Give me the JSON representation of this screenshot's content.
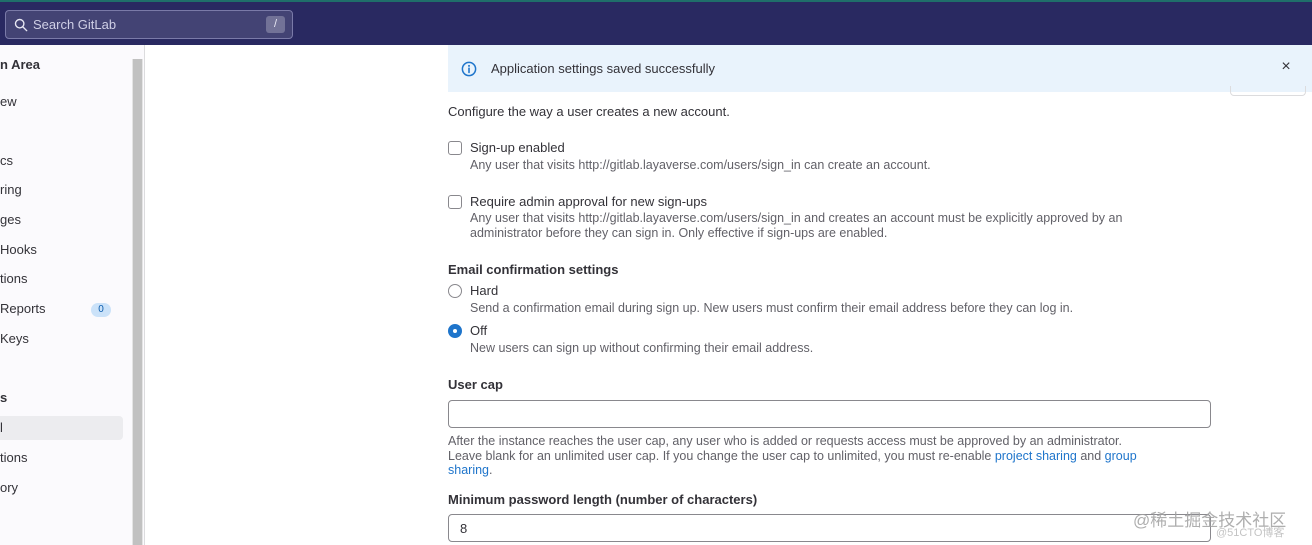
{
  "search": {
    "placeholder": "Search GitLab",
    "shortcut": "/"
  },
  "sidebar": {
    "items": [
      {
        "label": "n Area",
        "bold": true
      },
      {
        "label": "ew"
      },
      {
        "label": "cs"
      },
      {
        "label": "ring"
      },
      {
        "label": "ges"
      },
      {
        "label": " Hooks"
      },
      {
        "label": "tions"
      },
      {
        "label": "Reports",
        "badge": "0"
      },
      {
        "label": "Keys"
      },
      {
        "label": "s",
        "bold": true
      },
      {
        "label": "l",
        "active": true
      },
      {
        "label": "tions"
      },
      {
        "label": "ory"
      }
    ]
  },
  "alert": {
    "message": "Application settings saved successfully",
    "close": "×"
  },
  "intro": "Configure the way a user creates a new account.",
  "signup": {
    "label": "Sign-up enabled",
    "help": "Any user that visits http://gitlab.layaverse.com/users/sign_in can create an account."
  },
  "approval": {
    "label": "Require admin approval for new sign-ups",
    "help_line1": "Any user that visits http://gitlab.layaverse.com/users/sign_in and creates an account must be explicitly approved by an",
    "help_line2": "administrator before they can sign in. Only effective if sign-ups are enabled."
  },
  "email_confirmation": {
    "title": "Email confirmation settings",
    "hard_label": "Hard",
    "hard_help": "Send a confirmation email during sign up. New users must confirm their email address before they can log in.",
    "off_label": "Off",
    "off_help": "New users can sign up without confirming their email address.",
    "selected": "Off"
  },
  "user_cap": {
    "title": "User cap",
    "value": "",
    "help_line1": "After the instance reaches the user cap, any user who is added or requests access must be approved by an administrator.",
    "help_line2_prefix": "Leave blank for an unlimited user cap. If you change the user cap to unlimited, you must re-enable ",
    "link_project": "project sharing",
    "and_text": " and ",
    "link_group_1": "group",
    "link_group_2": "sharing",
    "period": "."
  },
  "min_password": {
    "title": "Minimum password length (number of characters)",
    "value": "8"
  },
  "watermark": {
    "main": "@稀土掘金技术社区",
    "sub": "@51CTO博客"
  },
  "colors": {
    "navbar": "#292961",
    "accent": "#1f75cb",
    "alert_bg": "#e9f3fc"
  }
}
